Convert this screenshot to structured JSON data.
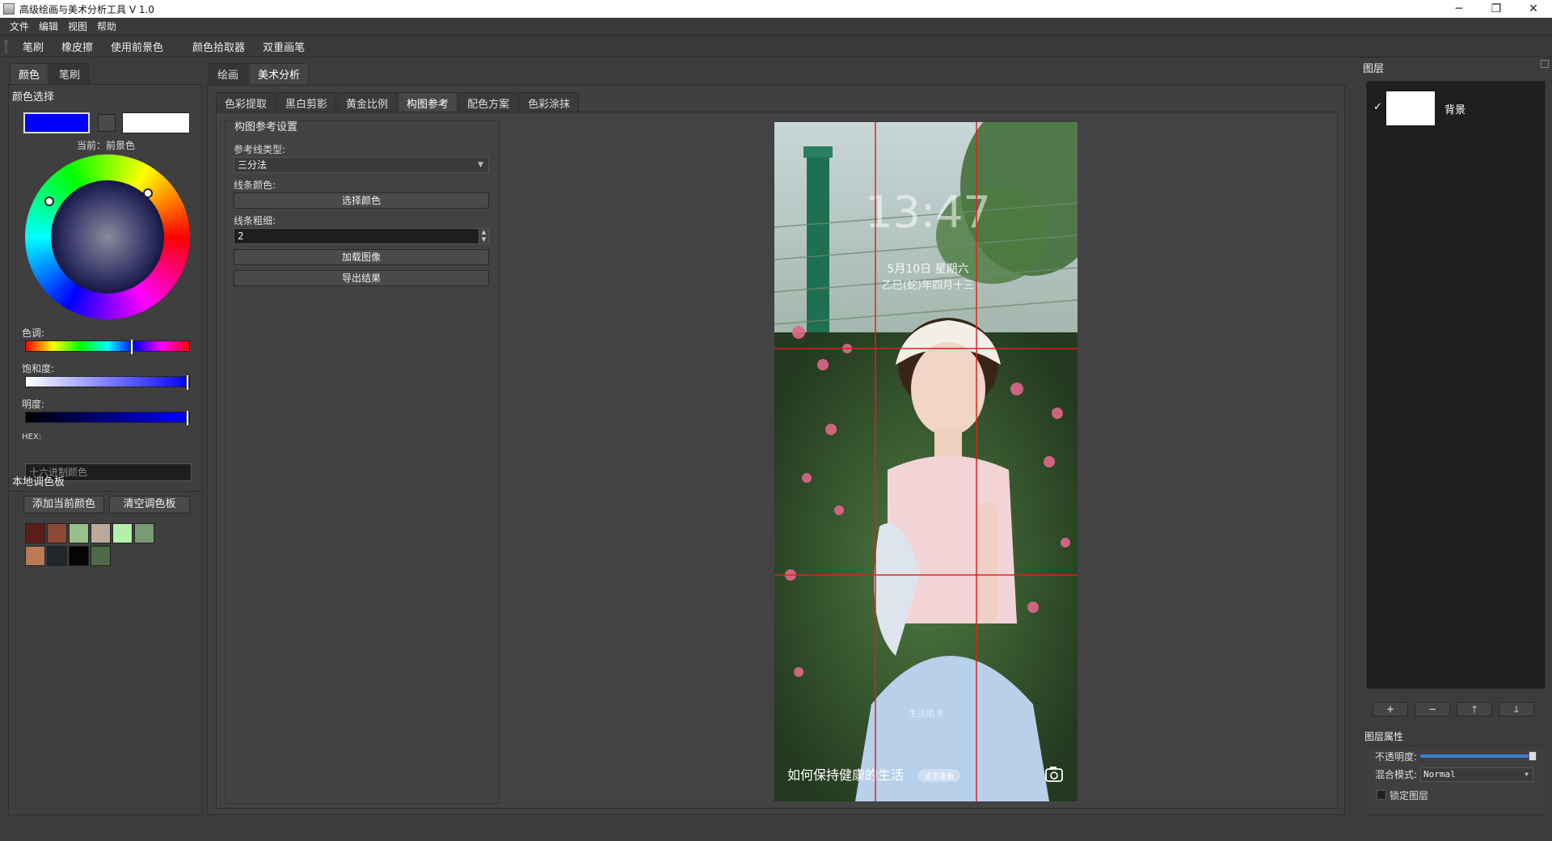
{
  "window": {
    "title": "高级绘画与美术分析工具 V 1.0",
    "min": "─",
    "max": "❐",
    "close": "✕"
  },
  "menu": [
    "文件",
    "编辑",
    "视图",
    "帮助"
  ],
  "toolbar": [
    "笔刷",
    "橡皮擦",
    "使用前景色",
    "颜色拾取器",
    "双重画笔"
  ],
  "left": {
    "tabs": [
      "颜色",
      "笔刷"
    ],
    "color_select_title": "颜色选择",
    "current_label": "当前：前景色",
    "foreground_color": "#0000ff",
    "background_color": "#ffffff",
    "hue_label": "色调:",
    "hue_value": 0.66,
    "saturation_label": "饱和度:",
    "saturation_value": 1.0,
    "value_label": "明度:",
    "value_value": 1.0,
    "hex_label": "HEX:",
    "hex_placeholder": "十六进制颜色",
    "palette_title": "本地调色板",
    "add_color_btn": "添加当前颜色",
    "clear_palette_btn": "清空调色板",
    "palette_colors": [
      "#5a1e18",
      "#8a4a35",
      "#98c08a",
      "#b9a99a",
      "#b4f0ac",
      "#7a9a76",
      "#b97a55",
      "#22262a",
      "#050505",
      "#4e6a48"
    ]
  },
  "center": {
    "tabs": [
      "绘画",
      "美术分析"
    ],
    "subtabs": [
      "色彩提取",
      "黑白剪影",
      "黄金比例",
      "构图参考",
      "配色方案",
      "色彩涂抹"
    ],
    "settings_title": "构图参考设置",
    "ref_type_label": "参考线类型:",
    "ref_type_value": "三分法",
    "line_color_label": "线条颜色:",
    "choose_color_btn": "选择颜色",
    "line_width_label": "线条粗细:",
    "line_width_value": "2",
    "load_image_btn": "加载图像",
    "export_btn": "导出结果",
    "image": {
      "clock": "13:47",
      "date1": "5月10日 星期六",
      "date2": "乙巳(蛇)年四月十三",
      "caption": "如何保持健康的生活",
      "caption_badge": "点击查看",
      "watermark": "生活助手"
    }
  },
  "right": {
    "layers_title": "图层",
    "layer_check": "✓",
    "layer_name": "背景",
    "ops": [
      "+",
      "−",
      "🡑",
      "🡓"
    ],
    "props_title": "图层属性",
    "opacity_label": "不透明度:",
    "opacity_value": 1.0,
    "blend_label": "混合模式:",
    "blend_value": "Normal",
    "lock_label": "锁定图层"
  }
}
